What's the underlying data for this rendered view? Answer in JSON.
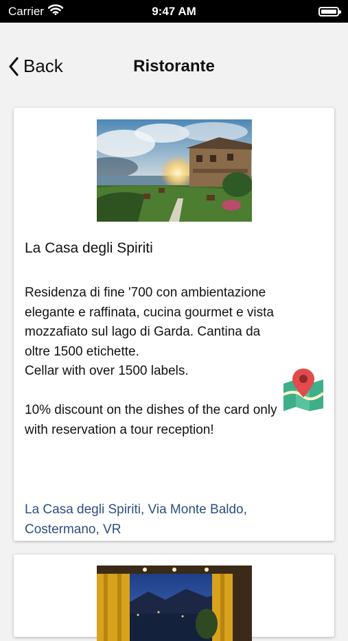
{
  "status_bar": {
    "carrier": "Carrier",
    "time": "9:47 AM",
    "wifi_icon": "wifi-icon",
    "battery_icon": "battery-icon"
  },
  "nav": {
    "back_label": "Back",
    "title": "Ristorante"
  },
  "cards": [
    {
      "title": "La Casa degli Spiriti",
      "description": "Residenza di fine '700 con ambientazione elegante e raffinata, cucina gourmet e vista mozzafiato sul lago di Garda. Cantina da oltre 1500 etichette.\nCellar with over 1500 labels.\n\n10% discount on the dishes of the card only with reservation a tour reception!",
      "address": "La Casa degli Spiriti, Via Monte Baldo, Costermano, VR",
      "map_icon": "map-pin-icon",
      "colors": {
        "address": "#2b4f80",
        "map_pin": "#e24b4b",
        "map_tiles": "#3daf8a"
      }
    }
  ]
}
